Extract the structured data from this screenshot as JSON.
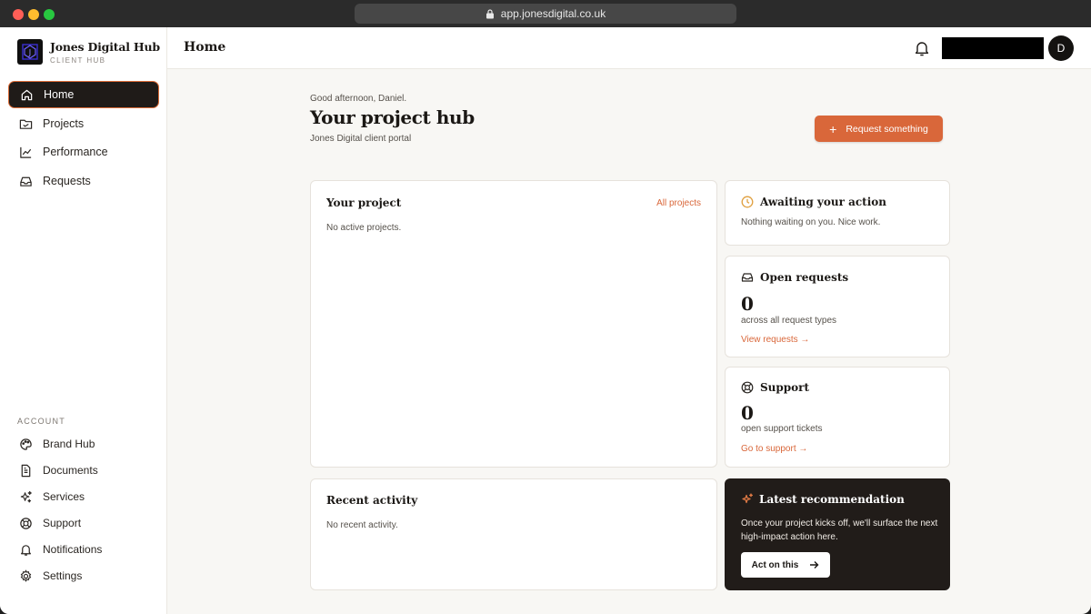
{
  "browser": {
    "url": "app.jonesdigital.co.uk"
  },
  "brand": {
    "name": "Jones Digital Hub",
    "subtitle": "CLIENT HUB"
  },
  "sidebar": {
    "items": [
      {
        "label": "Home",
        "icon": "home-icon",
        "active": true
      },
      {
        "label": "Projects",
        "icon": "folder-icon"
      },
      {
        "label": "Performance",
        "icon": "chart-line-icon"
      },
      {
        "label": "Requests",
        "icon": "inbox-icon"
      }
    ],
    "account_label": "ACCOUNT",
    "account_items": [
      {
        "label": "Brand Hub",
        "icon": "palette-icon"
      },
      {
        "label": "Documents",
        "icon": "document-icon"
      },
      {
        "label": "Services",
        "icon": "sparkles-icon"
      },
      {
        "label": "Support",
        "icon": "lifebuoy-icon"
      },
      {
        "label": "Notifications",
        "icon": "bell-icon"
      },
      {
        "label": "Settings",
        "icon": "gear-icon"
      }
    ]
  },
  "header": {
    "title": "Home",
    "avatar_initial": "D"
  },
  "main": {
    "greeting": "Good afternoon, Daniel.",
    "title": "Your project hub",
    "subtitle": "Jones Digital client portal",
    "request_button": "Request something",
    "project_card": {
      "title": "Your project",
      "link": "All projects",
      "empty": "No active projects."
    },
    "awaiting_card": {
      "title": "Awaiting your action",
      "text": "Nothing waiting on you. Nice work."
    },
    "requests_card": {
      "title": "Open requests",
      "count": "0",
      "caption": "across all request types",
      "link": "View requests →"
    },
    "support_card": {
      "title": "Support",
      "count": "0",
      "caption": "open support tickets",
      "link": "Go to support →"
    },
    "activity_card": {
      "title": "Recent activity",
      "empty": "No recent activity."
    },
    "recommendation_card": {
      "title": "Latest recommendation",
      "text": "Once your project kicks off, we'll surface the next high-impact action here.",
      "button": "Act on this"
    }
  },
  "colors": {
    "accent": "#d9673a",
    "dark": "#211c19",
    "background": "#f8f7f4"
  }
}
